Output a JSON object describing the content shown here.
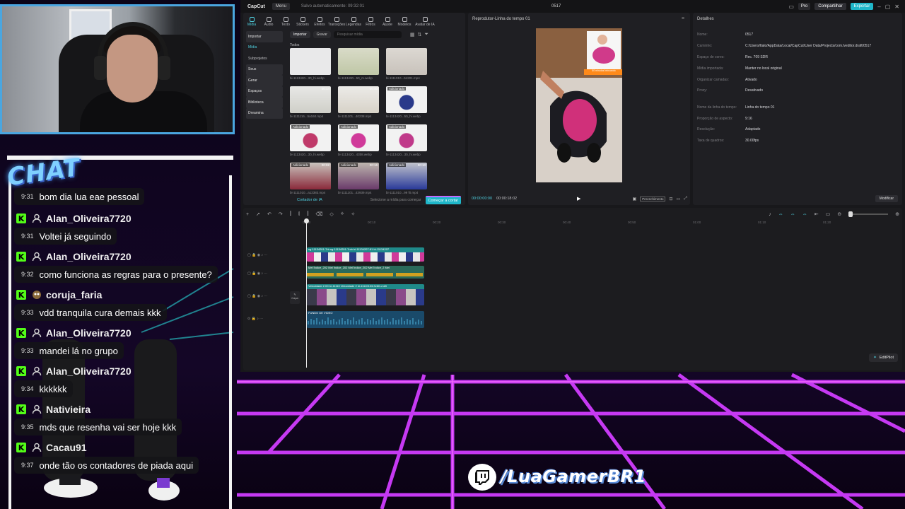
{
  "colors": {
    "accent": "#1fb7c9",
    "kick": "#53fc18",
    "grid_neon": "#d03cff",
    "chat_logo": "#7fd0ff"
  },
  "titlebar": {
    "logo": "CapCut",
    "menu": "Menu",
    "save_status": "Salvo automaticamente: 09:32:01",
    "project": "0517",
    "pro": "Pro",
    "share": "Compartilhar",
    "export": "Exportar"
  },
  "toolbar": [
    {
      "label": "Mídia"
    },
    {
      "label": "Áudio"
    },
    {
      "label": "Texto"
    },
    {
      "label": "Stickers"
    },
    {
      "label": "Efeitos"
    },
    {
      "label": "Transições"
    },
    {
      "label": "Legendas"
    },
    {
      "label": "Filtros"
    },
    {
      "label": "Ajuste"
    },
    {
      "label": "Modelos"
    },
    {
      "label": "Avatar de IA"
    }
  ],
  "side_nav": [
    {
      "label": "Importar"
    },
    {
      "label": "Mídia"
    },
    {
      "label": "Subprojetos"
    },
    {
      "label": "Seus"
    },
    {
      "label": "Gerar"
    },
    {
      "label": "Espaços"
    },
    {
      "label": "Biblioteca"
    },
    {
      "label": "Dreamina"
    }
  ],
  "media": {
    "import": "Importar",
    "record": "Gravar",
    "search_placeholder": "Pesquisar mídia",
    "section": "Todos",
    "thumbs": [
      {
        "name": "bi-1113420...30_hi.webp",
        "badge": "",
        "dur": ""
      },
      {
        "name": "bi-1113430...50_m.webp",
        "badge": "",
        "dur": ""
      },
      {
        "name": "bi-1111010...54201.mp4",
        "badge": "",
        "dur": ""
      },
      {
        "name": "bi-1111116...5a160.mp4",
        "badge": "",
        "dur": "00:14"
      },
      {
        "name": "bi-1111101...40238.mp4",
        "badge": "",
        "dur": "00:40"
      },
      {
        "name": "bi-1113420...50_hi.webp",
        "badge": "Adicionado",
        "dur": ""
      },
      {
        "name": "bi-1113420...30_hi.webp",
        "badge": "Adicionado",
        "dur": ""
      },
      {
        "name": "bi-1113420...43b8.webp",
        "badge": "Adicionado",
        "dur": ""
      },
      {
        "name": "bi-1113420...30_hi.webp",
        "badge": "Adicionado",
        "dur": ""
      },
      {
        "name": "bi-1111010...a12383.mp4",
        "badge": "Adicionado",
        "dur": "00:02"
      },
      {
        "name": "bi-1111101...43939.mp4",
        "badge": "Adicionado",
        "dur": "00:16"
      },
      {
        "name": "bi-1111010...99 f0.mp4",
        "badge": "Adicionado",
        "dur": "00:10"
      }
    ],
    "ai_cutter": "Cortador de IA",
    "select_hint": "Selecione a mídia para começar",
    "start_cut": "Começar a cortar"
  },
  "player": {
    "title": "Reprodutor-Linha do tempo 01",
    "current": "00:00:00:00",
    "total": "00:00:18:02",
    "full": "Preenchimento",
    "preview_caption": "50 minutos brincando"
  },
  "details": {
    "title": "Detalhes",
    "rows": [
      {
        "label": "Nome:",
        "value": "0517"
      },
      {
        "label": "Caminho:",
        "value": "C:/Users/Italo/AppData/Local/CapCut/User Data/Projects/com.lveditor.draft/0517"
      },
      {
        "label": "Espaço de cores:",
        "value": "Rec. 709 SDR"
      },
      {
        "label": "Mídia importada:",
        "value": "Manter no local original"
      },
      {
        "label": "Organizar camadas:",
        "value": "Ativado"
      },
      {
        "label": "Proxy:",
        "value": "Desativado"
      },
      {
        "label": "Nome da linha do tempo:",
        "value": "Linha do tempo 01"
      },
      {
        "label": "Proporção de aspecto:",
        "value": "9:16"
      },
      {
        "label": "Resolução:",
        "value": "Adaptado"
      },
      {
        "label": "Taxa de quadros:",
        "value": "30.00fps"
      }
    ],
    "modify": "Modificar"
  },
  "timeline": {
    "ticks": [
      "00:00",
      "00:10",
      "00:20",
      "00:30",
      "00:40",
      "00:50",
      "01:00",
      "01:10",
      "01:20"
    ],
    "capa": "Capa",
    "strips": [
      {
        "label": "sg-11134201-7rb  sg-11134201-7rcb  bi-11134207-81  bi-11134207"
      },
      {
        "label": "Mel Índice_202  Mel Índice_202  Mel Índice_202  Mel Índice_2  Mel"
      },
      {
        "label": "Velocidade 2.0X  bi-11110  Velocidade 2  bi-11110103-9v6l1-mk5"
      },
      {
        "label": "FUNDO DE VIDEO"
      }
    ],
    "editpilot": "EditPilot"
  },
  "chat": {
    "logo": "CHAT",
    "messages": [
      {
        "user": "",
        "time": "9:31",
        "text": "bom dia lua eae pessoal",
        "badge": ""
      },
      {
        "user": "Alan_Oliveira7720",
        "time": "9:31",
        "text": "Voltei já seguindo",
        "badge": "user"
      },
      {
        "user": "Alan_Oliveira7720",
        "time": "9:32",
        "text": "como funciona as regras para o presente?",
        "badge": "user"
      },
      {
        "user": "coruja_faria",
        "time": "9:33",
        "text": "vdd tranquila cura demais kkk",
        "badge": "owl"
      },
      {
        "user": "Alan_Oliveira7720",
        "time": "9:33",
        "text": "mandei lá no grupo",
        "badge": "user"
      },
      {
        "user": "Alan_Oliveira7720",
        "time": "9:34",
        "text": "kkkkkk",
        "badge": "user"
      },
      {
        "user": "Nativieira",
        "time": "9:35",
        "text": "mds que resenha vai ser hoje kkk",
        "badge": "user"
      },
      {
        "user": "Cacau91",
        "time": "9:37",
        "text": "onde tão os contadores de piada aqui",
        "badge": "user"
      }
    ]
  },
  "channel": {
    "name": "/LuaGamerBR1"
  }
}
